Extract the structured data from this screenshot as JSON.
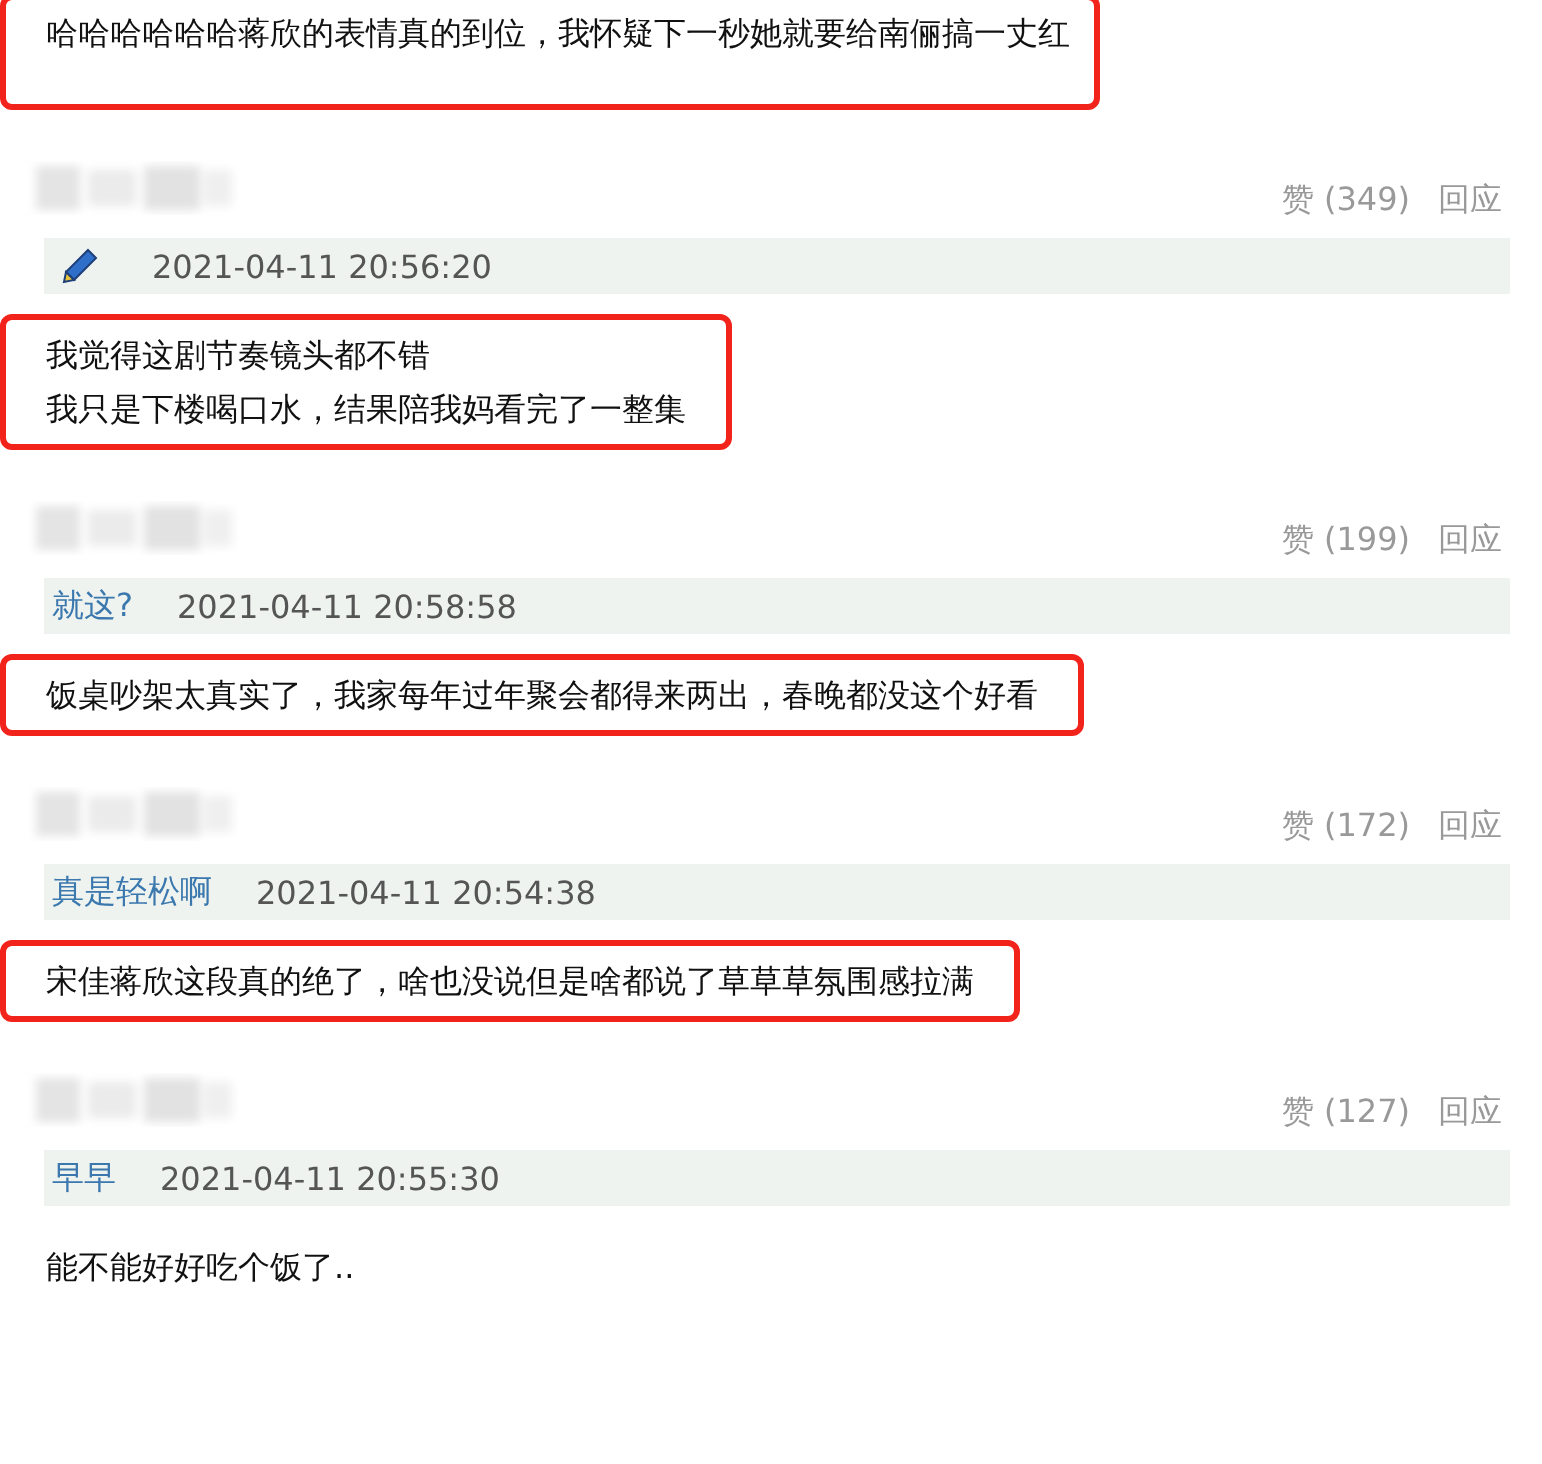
{
  "top_comment": {
    "lines": [
      "哈哈哈哈哈哈蒋欣的表情真的到位，我怀疑下一秒她就要给南俪搞一丈红"
    ],
    "highlighted": true
  },
  "comments": [
    {
      "likes": "赞 (349)",
      "reply": "回应",
      "author": {
        "kind": "icon"
      },
      "time": "2021-04-11 20:56:20",
      "lines": [
        "我觉得这剧节奏镜头都不错",
        "我只是下楼喝口水，结果陪我妈看完了一整集"
      ],
      "highlighted": true
    },
    {
      "likes": "赞 (199)",
      "reply": "回应",
      "author": {
        "kind": "name",
        "name": "就这?"
      },
      "time": "2021-04-11 20:58:58",
      "lines": [
        "饭桌吵架太真实了，我家每年过年聚会都得来两出，春晚都没这个好看"
      ],
      "highlighted": true
    },
    {
      "likes": "赞 (172)",
      "reply": "回应",
      "author": {
        "kind": "name",
        "name": "真是轻松啊"
      },
      "time": "2021-04-11 20:54:38",
      "lines": [
        "宋佳蒋欣这段真的绝了，啥也没说但是啥都说了草草草氛围感拉满"
      ],
      "highlighted": true
    },
    {
      "likes": "赞 (127)",
      "reply": "回应",
      "author": {
        "kind": "name",
        "name": "早早"
      },
      "time": "2021-04-11 20:55:30",
      "lines": [
        "能不能好好吃个饭了.."
      ],
      "highlighted": false
    }
  ]
}
